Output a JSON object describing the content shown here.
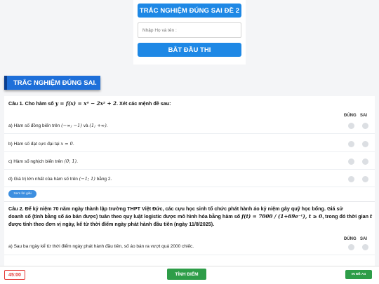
{
  "header": {
    "title": "TRẮC NGHIỆM ĐÚNG SAI ĐỀ 2",
    "name_placeholder": "Nhập Họ và tên :",
    "start_label": "BẮT ĐẦU THI"
  },
  "section": {
    "title": "TRẮC NGHIỆM ĐÚNG SAI."
  },
  "columns": {
    "true_label": "ĐÚNG",
    "false_label": "SAI"
  },
  "question1": {
    "prefix": "Câu 1. Cho hàm số ",
    "formula": "y = f(x) = x⁴ − 2x² + 2",
    "suffix": ". Xét các mệnh đề sau:",
    "options": [
      {
        "text": "a) Hàm số đồng biến trên ",
        "math": "(−∞; −1)",
        "mid": " và ",
        "math2": "(1; +∞)",
        "end": "."
      },
      {
        "text": "b) Hàm số đạt cực đại tại ",
        "math": "x = 0",
        "mid": "",
        "math2": "",
        "end": "."
      },
      {
        "text": "c) Hàm số nghịch biến trên ",
        "math": "(0; 1)",
        "mid": "",
        "math2": "",
        "end": "."
      },
      {
        "text": "d) Giá trị lớn nhất của hàm số trên ",
        "math": "(−1; 1)",
        "mid": " bằng 2.",
        "math2": "",
        "end": ""
      }
    ],
    "explain_label": "Xem lời giải"
  },
  "question2": {
    "line1": "Câu 2. Để kỷ niệm 70 năm ngày thành lập trường THPT Việt Đức, các cựu học sinh tổ chức phát hành áo kỷ niệm gây quỹ học bổng. Giá sử",
    "line2a": "doanh số (tính bằng số áo bán được) tuân theo quy luật logistic được mô hình hóa bằng hàm số ",
    "formula": "f(t) = 7000 / (1+69e⁻ᵗ), t ≥ 0",
    "line2b": ", trong đó thời gian ",
    "tvar": "t",
    "line3": "được tính theo đơn vị ngày, kể từ thời điểm ngày phát hành đầu tiên (ngày 11/8/2025).",
    "option_a": "a) Sau ba ngày kể từ thời điểm ngày phát hành đầu tiên, số áo bán ra vượt quá 2000 chiếc."
  },
  "footer": {
    "timer": "45:00",
    "submit_label": "TÍNH ĐIỂM",
    "print_label": "IN ĐỀ A4"
  }
}
